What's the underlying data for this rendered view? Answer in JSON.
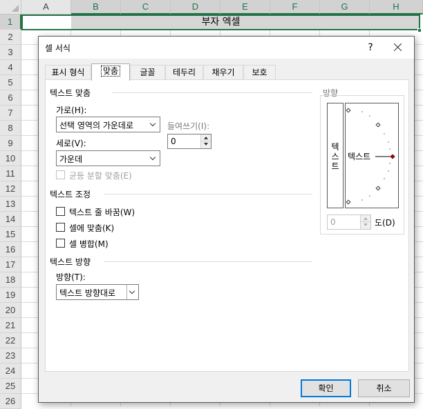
{
  "sheet": {
    "columns": [
      "A",
      "B",
      "C",
      "D",
      "E",
      "F",
      "G",
      "H"
    ],
    "rows": [
      "1",
      "2",
      "3",
      "4",
      "5",
      "6",
      "7",
      "8",
      "9",
      "10",
      "11",
      "12",
      "13",
      "14",
      "15",
      "16",
      "17",
      "18",
      "19",
      "20",
      "21",
      "22",
      "23",
      "24",
      "25",
      "26"
    ],
    "merged_cell_text": "부자 엑셀",
    "accent_color": "#217346"
  },
  "dialog": {
    "title": "셀 서식",
    "help_label": "?",
    "tabs": [
      {
        "label": "표시 형식"
      },
      {
        "label": "맞춤",
        "active": true
      },
      {
        "label": "글꼴"
      },
      {
        "label": "테두리"
      },
      {
        "label": "채우기"
      },
      {
        "label": "보호"
      }
    ],
    "text_alignment": {
      "title": "텍스트 맞춤",
      "horizontal_label": "가로(H):",
      "horizontal_value": "선택 영역의 가운데로",
      "indent_label": "들여쓰기(I):",
      "indent_value": "0",
      "vertical_label": "세로(V):",
      "vertical_value": "가운데",
      "distributed_label": "균등 분할 맞춤(E)",
      "distributed_checked": false
    },
    "text_control": {
      "title": "텍스트 조정",
      "wrap_label": "텍스트 줄 바꿈(W)",
      "wrap_checked": false,
      "shrink_label": "셀에 맞춤(K)",
      "shrink_checked": false,
      "merge_label": "셀 병합(M)",
      "merge_checked": false
    },
    "text_direction": {
      "title": "텍스트 방향",
      "direction_label": "방향(T):",
      "direction_value": "텍스트 방향대로"
    },
    "orientation": {
      "title": "방향",
      "vertical_text": "텍스트",
      "dial_text": "텍스트",
      "degrees_value": "0",
      "degrees_label": "도(D)",
      "dial_marker_color": "#c00000"
    },
    "ok_label": "확인",
    "cancel_label": "취소",
    "default_button_color": "#0078d7"
  }
}
